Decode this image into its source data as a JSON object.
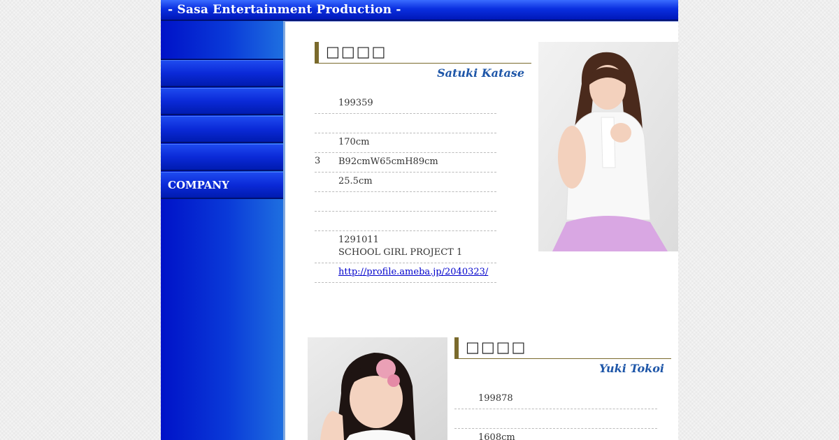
{
  "header": {
    "title": "- Sasa Entertainment Production -"
  },
  "sidebar": {
    "items": [
      {
        "label": ""
      },
      {
        "label": ""
      },
      {
        "label": ""
      },
      {
        "label": ""
      },
      {
        "label": ""
      },
      {
        "label": "COMPANY"
      }
    ]
  },
  "profiles": [
    {
      "name_jp": "□□□□",
      "name_en": "Satuki Katase",
      "rows": [
        {
          "key": "",
          "value": "199359"
        },
        {
          "key": "",
          "value": ""
        },
        {
          "key": "",
          "value": "170cm"
        },
        {
          "key": "3",
          "value": "B92cmW65cmH89cm"
        },
        {
          "key": "",
          "value": "25.5cm"
        },
        {
          "key": "",
          "value": ""
        },
        {
          "key": "",
          "value": ""
        },
        {
          "key": "",
          "value": "1291011",
          "value2": "SCHOOL GIRL PROJECT 1"
        },
        {
          "key": "",
          "link": "http://profile.ameba.jp/2040323/"
        }
      ]
    },
    {
      "name_jp": "□□□□",
      "name_en": "Yuki Tokoi",
      "rows": [
        {
          "key": "",
          "value": "199878"
        },
        {
          "key": "",
          "value": ""
        },
        {
          "key": "",
          "value": "1608cm"
        }
      ]
    }
  ],
  "colors": {
    "nav_blue": "#0b2ad8",
    "accent_gold": "#7a6a2c",
    "name_en_blue": "#1e56a8",
    "link": "#0000cc"
  }
}
